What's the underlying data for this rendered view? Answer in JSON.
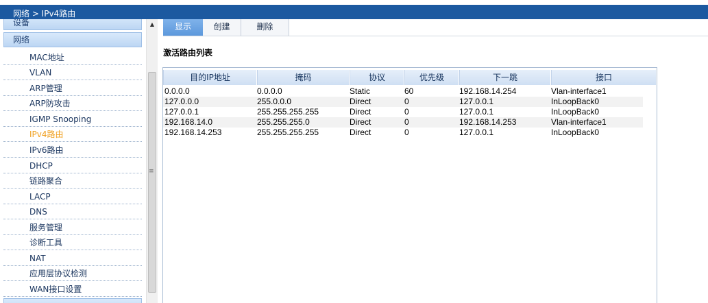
{
  "header": {
    "breadcrumb": "网络 > IPv4路由"
  },
  "sidebar": {
    "groups": [
      {
        "label": "设备"
      },
      {
        "label": "网络"
      }
    ],
    "items": [
      {
        "label": "MAC地址",
        "active": false
      },
      {
        "label": "VLAN",
        "active": false
      },
      {
        "label": "ARP管理",
        "active": false
      },
      {
        "label": "ARP防攻击",
        "active": false
      },
      {
        "label": "IGMP Snooping",
        "active": false
      },
      {
        "label": "IPv4路由",
        "active": true
      },
      {
        "label": "IPv6路由",
        "active": false
      },
      {
        "label": "DHCP",
        "active": false
      },
      {
        "label": "链路聚合",
        "active": false
      },
      {
        "label": "LACP",
        "active": false
      },
      {
        "label": "DNS",
        "active": false
      },
      {
        "label": "服务管理",
        "active": false
      },
      {
        "label": "诊断工具",
        "active": false
      },
      {
        "label": "NAT",
        "active": false
      },
      {
        "label": "应用层协议检测",
        "active": false
      },
      {
        "label": "WAN接口设置",
        "active": false
      }
    ]
  },
  "tabs": [
    {
      "label": "显示",
      "active": true
    },
    {
      "label": "创建",
      "active": false
    },
    {
      "label": "删除",
      "active": false
    }
  ],
  "main": {
    "title": "激活路由列表",
    "columns": [
      "目的IP地址",
      "掩码",
      "协议",
      "优先级",
      "下一跳",
      "接口"
    ],
    "rows": [
      [
        "0.0.0.0",
        "0.0.0.0",
        "Static",
        "60",
        "192.168.14.254",
        "Vlan-interface1"
      ],
      [
        "127.0.0.0",
        "255.0.0.0",
        "Direct",
        "0",
        "127.0.0.1",
        "InLoopBack0"
      ],
      [
        "127.0.0.1",
        "255.255.255.255",
        "Direct",
        "0",
        "127.0.0.1",
        "InLoopBack0"
      ],
      [
        "192.168.14.0",
        "255.255.255.0",
        "Direct",
        "0",
        "192.168.14.253",
        "Vlan-interface1"
      ],
      [
        "192.168.14.253",
        "255.255.255.255",
        "Direct",
        "0",
        "127.0.0.1",
        "InLoopBack0"
      ]
    ]
  },
  "colors": {
    "header_bg": "#1c59a0",
    "active_item": "#f0a020",
    "active_tab": "#5c98dc"
  }
}
